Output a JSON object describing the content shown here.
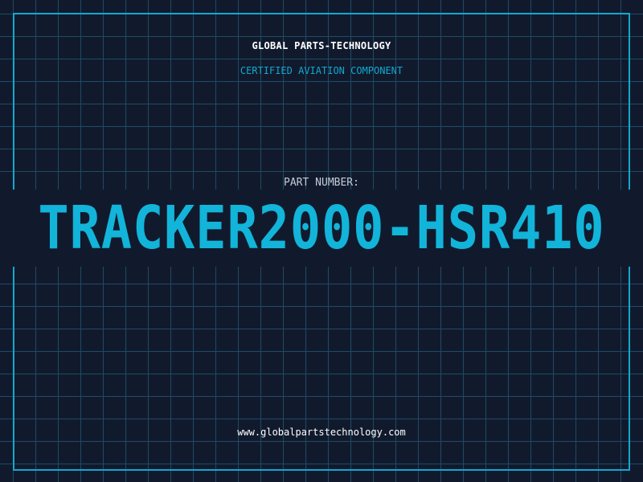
{
  "header": {
    "company_name": "GLOBAL PARTS-TECHNOLOGY",
    "tagline": "CERTIFIED AVIATION COMPONENT"
  },
  "part": {
    "label": "PART NUMBER:",
    "number": "TRACKER2000-HSR410"
  },
  "footer": {
    "website": "www.globalpartstechnology.com"
  },
  "colors": {
    "background": "#111a2d",
    "grid": "#1f4a63",
    "accent": "#12a8cf",
    "text": "#ffffff"
  }
}
